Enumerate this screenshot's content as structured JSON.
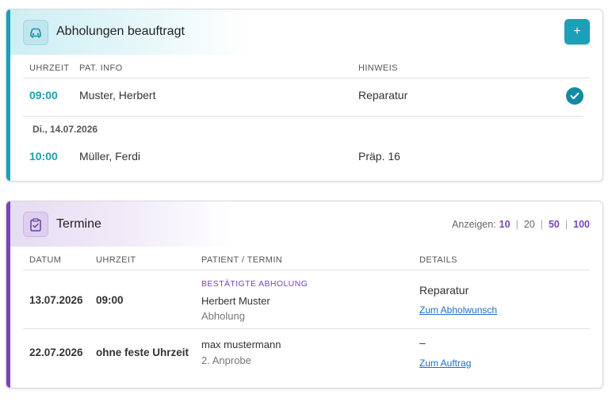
{
  "pickups": {
    "title": "Abholungen beauftragt",
    "add_label": "+",
    "columns": [
      "UHRZEIT",
      "PAT. INFO",
      "HINWEIS"
    ],
    "rows": [
      {
        "time": "09:00",
        "patient": "Muster, Herbert",
        "note": "Reparatur",
        "done": true
      }
    ],
    "date_group": "Di., 14.07.2026",
    "group_rows": [
      {
        "time": "10:00",
        "patient": "Müller, Ferdi",
        "note": "Präp. 16"
      }
    ],
    "accent_color": "#1aa0b8"
  },
  "appointments": {
    "title": "Termine",
    "pager": {
      "label": "Anzeigen:",
      "options": [
        "10",
        "20",
        "50",
        "100"
      ],
      "active": "10"
    },
    "columns": [
      "DATUM",
      "UHRZEIT",
      "PATIENT / TERMIN",
      "DETAILS"
    ],
    "rows": [
      {
        "date": "13.07.2026",
        "time": "09:00",
        "tag": "BESTÄTIGTE ABHOLUNG",
        "patient": "Herbert Muster",
        "type": "Abholung",
        "detail": "Reparatur",
        "link": "Zum Abholwunsch"
      },
      {
        "date": "22.07.2026",
        "time": "ohne feste Uhrzeit",
        "patient": "max mustermann",
        "type": "2. Anprobe",
        "detail": "–",
        "link": "Zum Auftrag"
      }
    ],
    "accent_color": "#7a45b8"
  },
  "icons": {
    "pickups": "car-icon",
    "appointments": "clipboard-check-icon",
    "done": "check-icon"
  }
}
